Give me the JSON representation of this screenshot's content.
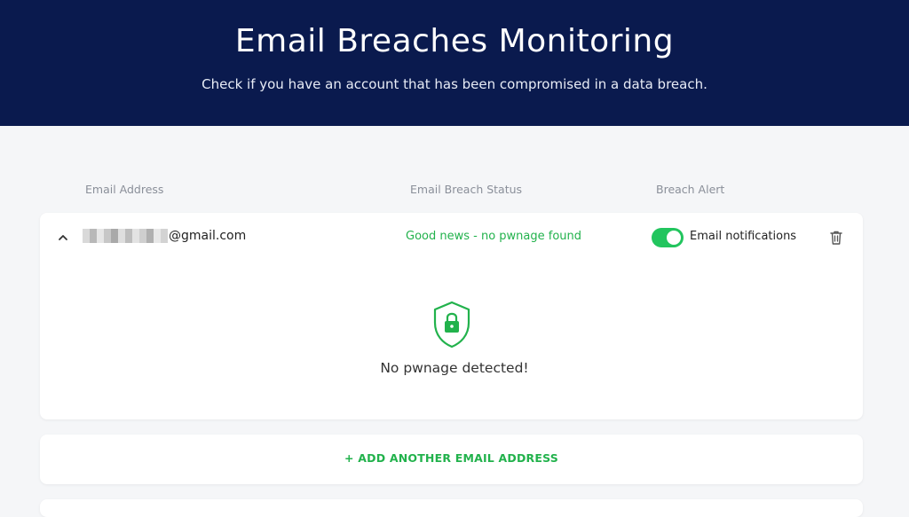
{
  "header": {
    "title": "Email Breaches Monitoring",
    "subtitle": "Check if you have an account that has been compromised in a data breach."
  },
  "columns": {
    "email": "Email Address",
    "status": "Email Breach Status",
    "alert": "Breach Alert"
  },
  "entry": {
    "email_suffix": "@gmail.com",
    "status": "Good news - no pwnage found",
    "notifications_label": "Email notifications",
    "notifications_enabled": true,
    "result_message": "No pwnage detected!"
  },
  "actions": {
    "add_email": "+ ADD ANOTHER EMAIL ADDRESS"
  },
  "colors": {
    "header_bg": "#0a1a4e",
    "accent_green": "#22b24c",
    "toggle_green": "#22c55e"
  },
  "icons": {
    "collapse": "chevron-up-icon",
    "delete": "trash-icon",
    "result": "shield-lock-icon"
  }
}
